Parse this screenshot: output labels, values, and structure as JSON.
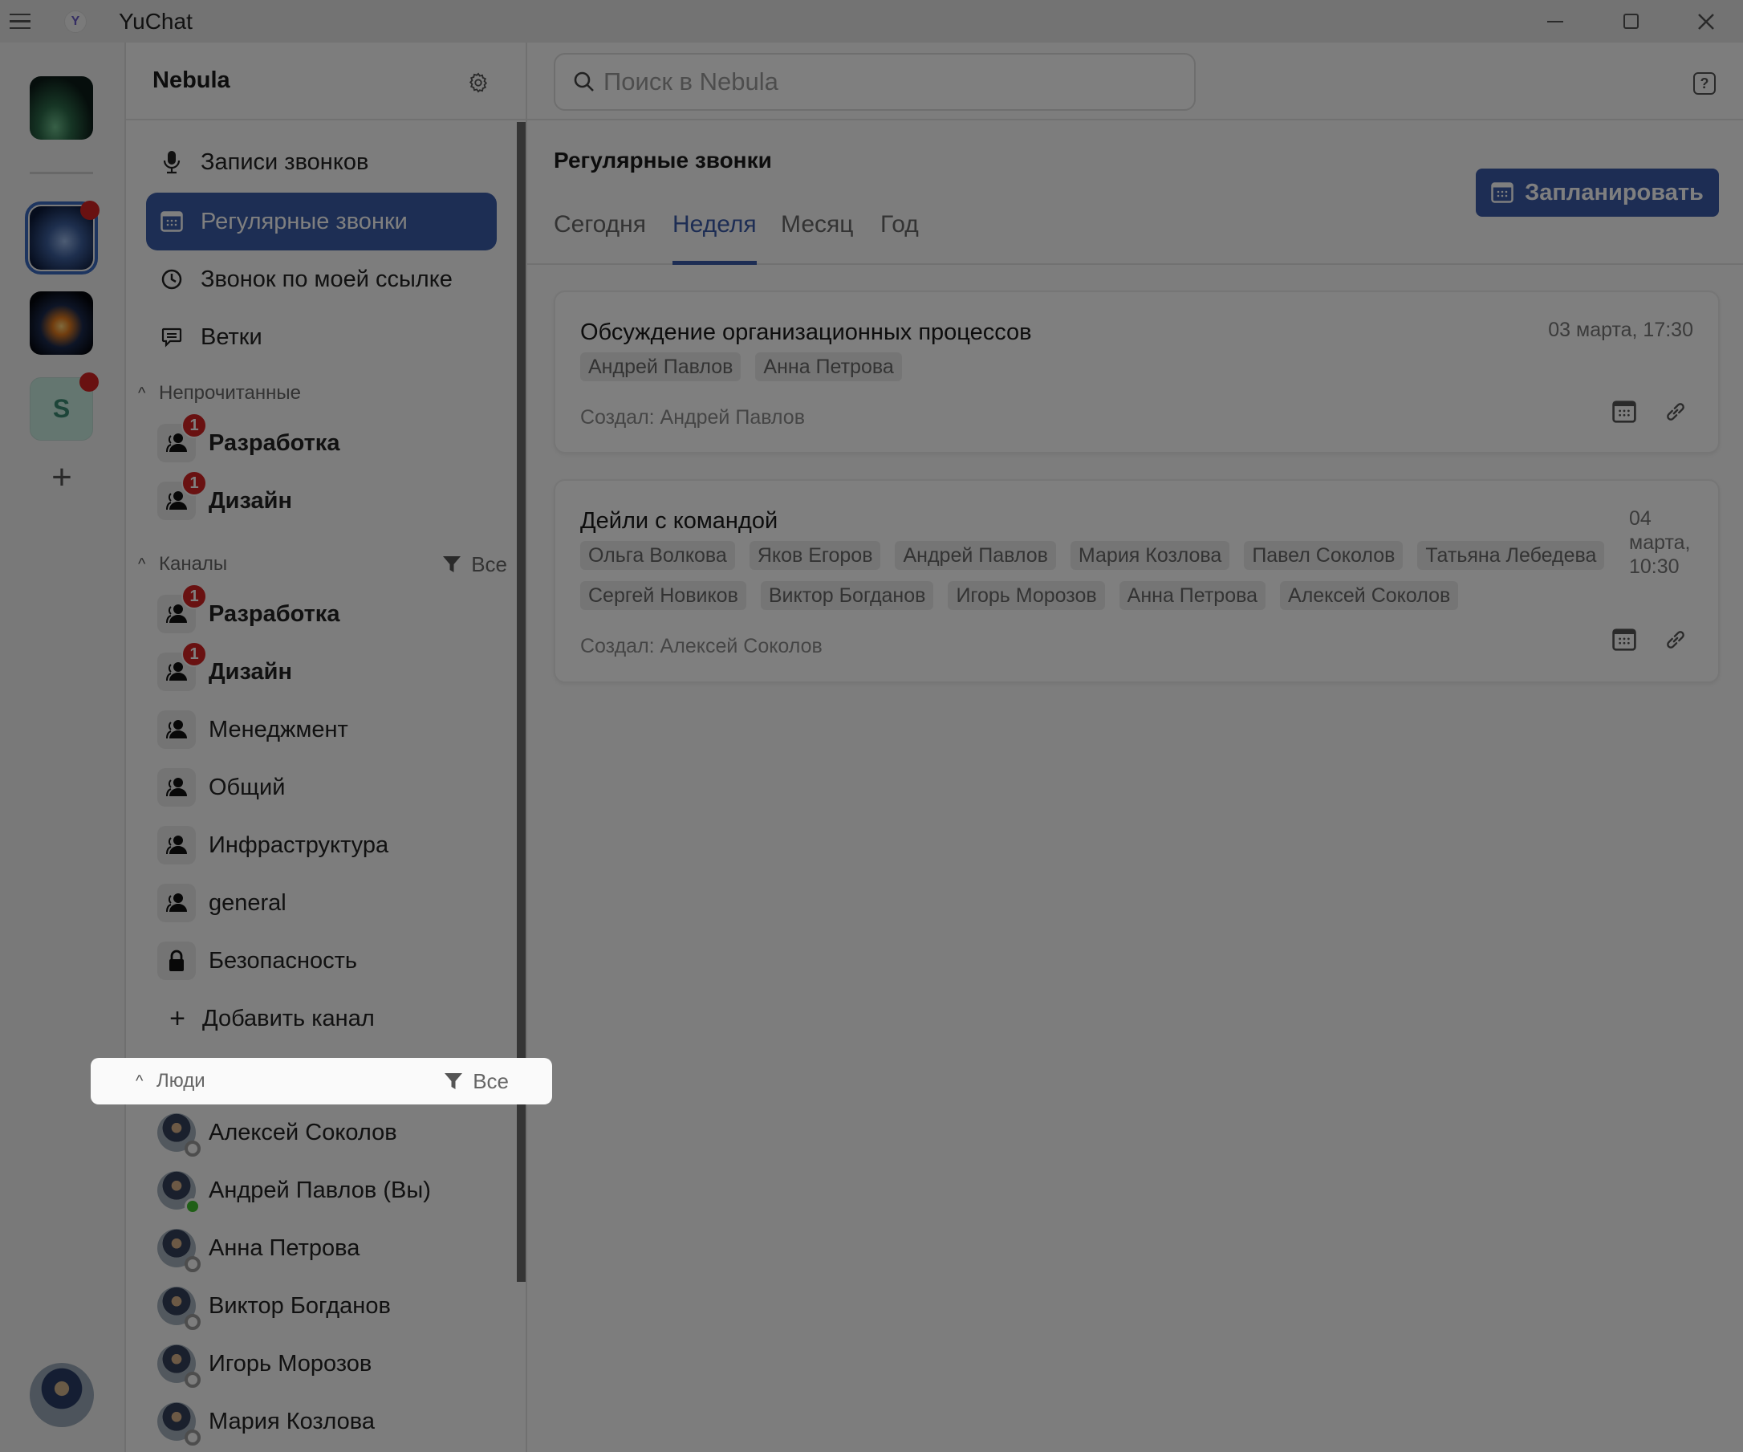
{
  "window": {
    "app_title": "YuChat",
    "controls": {
      "minimize": "minimize",
      "maximize": "maximize",
      "close": "close"
    }
  },
  "rail": {
    "workspaces": [
      {
        "name": "aurora-workspace",
        "unread": false,
        "active": false
      },
      {
        "name": "nebula-workspace",
        "unread": true,
        "active": true
      },
      {
        "name": "cosmic-workspace",
        "unread": false,
        "active": false
      },
      {
        "name": "s-workspace",
        "letter": "S",
        "unread": true,
        "active": false
      }
    ],
    "add_label": "+"
  },
  "sidebar": {
    "workspace_name": "Nebula",
    "nav": [
      {
        "label": "Записи звонков",
        "icon": "microphone-icon",
        "active": false
      },
      {
        "label": "Регулярные звонки",
        "icon": "calendar-icon",
        "active": true
      },
      {
        "label": "Звонок по моей ссылке",
        "icon": "clock-icon",
        "active": false
      },
      {
        "label": "Ветки",
        "icon": "threads-icon",
        "active": false
      }
    ],
    "unread": {
      "title": "Непрочитанные",
      "items": [
        {
          "label": "Разработка",
          "badge": "1"
        },
        {
          "label": "Дизайн",
          "badge": "1"
        }
      ]
    },
    "channels": {
      "title": "Каналы",
      "filter_label": "Все",
      "items": [
        {
          "label": "Разработка",
          "badge": "1",
          "icon": "group-icon"
        },
        {
          "label": "Дизайн",
          "badge": "1",
          "icon": "group-icon"
        },
        {
          "label": "Менеджмент",
          "icon": "group-icon"
        },
        {
          "label": "Общий",
          "icon": "group-icon"
        },
        {
          "label": "Инфраструктура",
          "icon": "group-icon"
        },
        {
          "label": "general",
          "icon": "group-icon"
        },
        {
          "label": "Безопасность",
          "icon": "lock-icon"
        }
      ],
      "add_label": "Добавить канал"
    },
    "people": {
      "title": "Люди",
      "filter_label": "Все",
      "items": [
        {
          "label": "Алексей Соколов",
          "status": "offline"
        },
        {
          "label": "Андрей Павлов (Вы)",
          "status": "online"
        },
        {
          "label": "Анна Петрова",
          "status": "offline"
        },
        {
          "label": "Виктор Богданов",
          "status": "offline"
        },
        {
          "label": "Игорь Морозов",
          "status": "offline"
        },
        {
          "label": "Мария Козлова",
          "status": "offline"
        }
      ]
    }
  },
  "main": {
    "search": {
      "placeholder": "Поиск в Nebula",
      "value": ""
    },
    "help_label": "?",
    "title": "Регулярные звонки",
    "schedule_button": "Запланировать",
    "tabs": [
      {
        "label": "Сегодня",
        "active": false
      },
      {
        "label": "Неделя",
        "active": true
      },
      {
        "label": "Месяц",
        "active": false
      },
      {
        "label": "Год",
        "active": false
      }
    ],
    "meetings": [
      {
        "title": "Обсуждение организационных процессов",
        "date": "03 марта, 17:30",
        "participants": [
          "Андрей Павлов",
          "Анна Петрова"
        ],
        "creator": "Создал: Андрей Павлов"
      },
      {
        "title": "Дейли с командой",
        "date": "04 марта, 10:30",
        "participants": [
          "Ольга Волкова",
          "Яков Егоров",
          "Андрей Павлов",
          "Мария Козлова",
          "Павел Соколов",
          "Татьяна Лебедева",
          "Сергей Новиков",
          "Виктор Богданов",
          "Игорь Морозов",
          "Анна Петрова",
          "Алексей Соколов"
        ],
        "creator": "Создал: Алексей Соколов"
      }
    ]
  },
  "colors": {
    "accent": "#3b5aa8",
    "badge": "#d32323",
    "online": "#3fbf2c",
    "overlay": "rgba(0,0,0,0.5)"
  }
}
